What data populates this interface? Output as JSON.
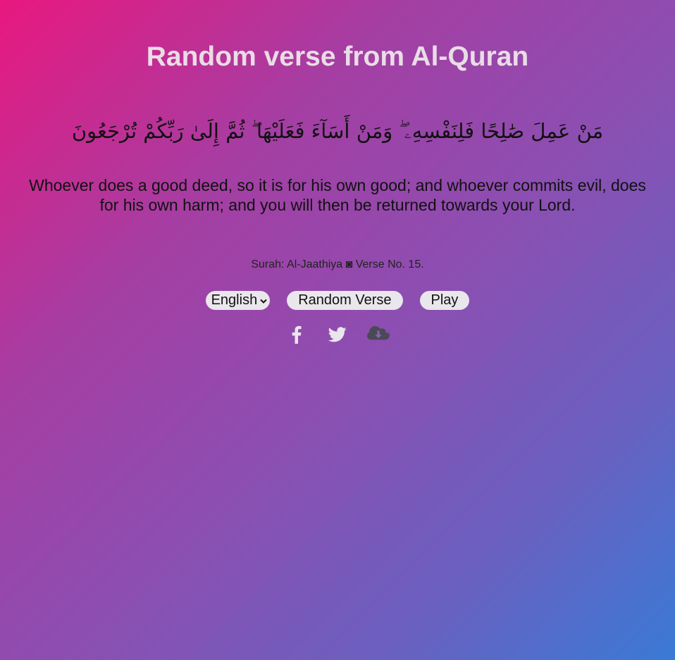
{
  "header": {
    "title": "Random verse from Al-Quran"
  },
  "verse": {
    "arabic": "مَنْ عَمِلَ صَٰلِحًا فَلِنَفْسِهِۦ ۖ وَمَنْ أَسَآءَ فَعَلَيْهَا ۖ ثُمَّ إِلَىٰ رَبِّكُمْ تُرْجَعُونَ",
    "translation": "Whoever does a good deed, so it is for his own good; and whoever commits evil, does for his own harm; and you will then be returned towards your Lord.",
    "reference": "Surah: Al-Jaathiya ◙ Verse No. 15."
  },
  "controls": {
    "language_selected": "English",
    "random_button_label": "Random Verse",
    "play_button_label": "Play"
  },
  "social": {
    "icons": [
      "facebook-icon",
      "twitter-icon",
      "cloud-download-icon"
    ],
    "colors": {
      "facebook": "#e9e6ec",
      "twitter": "#e9e6ec",
      "download": "#4a4a55"
    }
  },
  "colors": {
    "gradient_start": "#e8187f",
    "gradient_end": "#3a7ad6",
    "title": "#e9dde6",
    "button_bg": "#e9e6ec"
  }
}
